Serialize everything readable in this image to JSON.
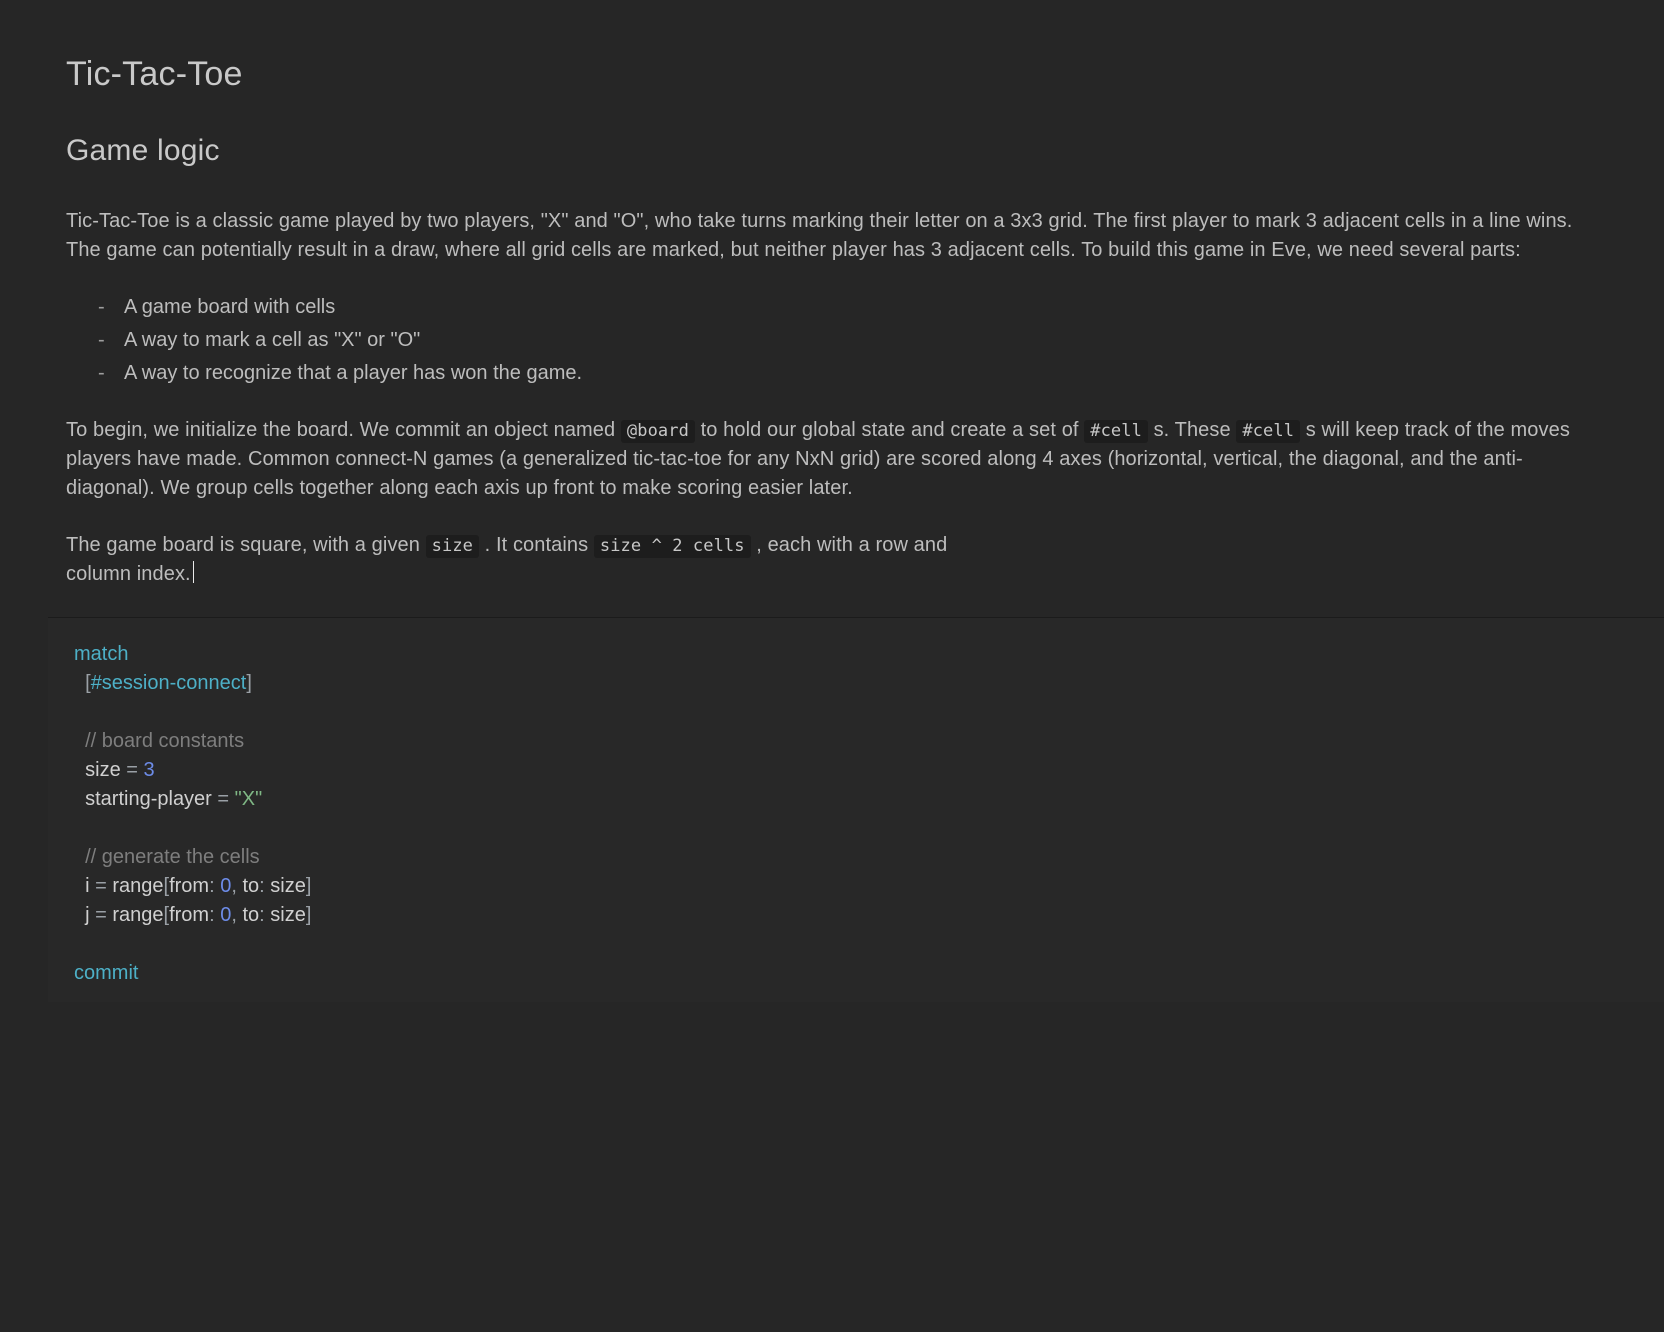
{
  "title": "Tic-Tac-Toe",
  "subtitle": "Game logic",
  "para1": "Tic-Tac-Toe is a classic game played by two players, \"X\" and \"O\", who take turns marking their letter on a 3x3 grid. The first player to mark 3 adjacent cells in a line wins. The game can potentially result in a draw, where all grid cells are marked, but neither player has 3 adjacent cells. To build this game in Eve, we need several parts:",
  "bullets": [
    "A game board with cells",
    "A way to mark a cell as \"X\" or \"O\"",
    "A way to recognize that a player has won the game."
  ],
  "para2a": "To begin, we initialize the board. We commit an object named ",
  "code_board": "@board",
  "para2b": " to hold our global state and create a set of ",
  "code_cell": "#cell",
  "para2c": " s. These ",
  "code_cell2": "#cell",
  "para2d": " s will keep track of the moves players have made. Common connect-N games (a generalized tic-tac-toe for any NxN grid) are scored along 4 axes (horizontal, vertical, the diagonal, and the anti-diagonal). We group cells together along each axis up front to make scoring easier later.",
  "para3a": "The game board is square, with a given ",
  "code_size": "size",
  "para3b": " . It contains ",
  "code_expr": "size ^ 2 cells",
  "para3c": " , each with a row and column index.",
  "code": {
    "kw_match": "match",
    "tag_session": "#session-connect",
    "comment1": "// board constants",
    "line_size_l": "size ",
    "op_eq": "=",
    "num_3": " 3",
    "line_sp_l": "starting-player ",
    "str_x": " \"X\"",
    "comment2": "// generate the cells",
    "i_l": "i ",
    "range_open": " range",
    "lbrack": "[",
    "from_lbl": "from",
    "colon": ": ",
    "num_0": "0",
    "comma": ", ",
    "to_lbl": "to",
    "size_ref": "size",
    "rbrack": "]",
    "j_l": "j ",
    "kw_commit": "commit"
  }
}
